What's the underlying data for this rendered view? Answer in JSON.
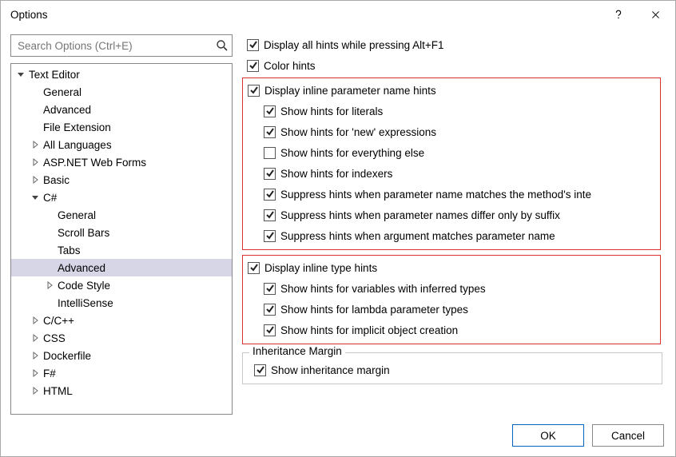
{
  "window": {
    "title": "Options"
  },
  "search": {
    "placeholder": "Search Options (Ctrl+E)"
  },
  "tree": [
    {
      "label": "Text Editor",
      "indent": 0,
      "expand": "open",
      "sel": false
    },
    {
      "label": "General",
      "indent": 1,
      "expand": "none",
      "sel": false
    },
    {
      "label": "Advanced",
      "indent": 1,
      "expand": "none",
      "sel": false
    },
    {
      "label": "File Extension",
      "indent": 1,
      "expand": "none",
      "sel": false
    },
    {
      "label": "All Languages",
      "indent": 1,
      "expand": "closed",
      "sel": false
    },
    {
      "label": "ASP.NET Web Forms",
      "indent": 1,
      "expand": "closed",
      "sel": false
    },
    {
      "label": "Basic",
      "indent": 1,
      "expand": "closed",
      "sel": false
    },
    {
      "label": "C#",
      "indent": 1,
      "expand": "open",
      "sel": false
    },
    {
      "label": "General",
      "indent": 2,
      "expand": "none",
      "sel": false
    },
    {
      "label": "Scroll Bars",
      "indent": 2,
      "expand": "none",
      "sel": false
    },
    {
      "label": "Tabs",
      "indent": 2,
      "expand": "none",
      "sel": false
    },
    {
      "label": "Advanced",
      "indent": 2,
      "expand": "none",
      "sel": true
    },
    {
      "label": "Code Style",
      "indent": 2,
      "expand": "closed",
      "sel": false
    },
    {
      "label": "IntelliSense",
      "indent": 2,
      "expand": "none",
      "sel": false
    },
    {
      "label": "C/C++",
      "indent": 1,
      "expand": "closed",
      "sel": false
    },
    {
      "label": "CSS",
      "indent": 1,
      "expand": "closed",
      "sel": false
    },
    {
      "label": "Dockerfile",
      "indent": 1,
      "expand": "closed",
      "sel": false
    },
    {
      "label": "F#",
      "indent": 1,
      "expand": "closed",
      "sel": false
    },
    {
      "label": "HTML",
      "indent": 1,
      "expand": "closed",
      "sel": false
    }
  ],
  "opts_top": [
    {
      "label": "Display all hints while pressing Alt+F1",
      "checked": true,
      "indent": 0
    },
    {
      "label": "Color hints",
      "checked": true,
      "indent": 0
    }
  ],
  "group1": [
    {
      "label": "Display inline parameter name hints",
      "checked": true,
      "indent": 0
    },
    {
      "label": "Show hints for literals",
      "checked": true,
      "indent": 1
    },
    {
      "label": "Show hints for 'new' expressions",
      "checked": true,
      "indent": 1
    },
    {
      "label": "Show hints for everything else",
      "checked": false,
      "indent": 1
    },
    {
      "label": "Show hints for indexers",
      "checked": true,
      "indent": 1
    },
    {
      "label": "Suppress hints when parameter name matches the method's inte",
      "checked": true,
      "indent": 1
    },
    {
      "label": "Suppress hints when parameter names differ only by suffix",
      "checked": true,
      "indent": 1
    },
    {
      "label": "Suppress hints when argument matches parameter name",
      "checked": true,
      "indent": 1
    }
  ],
  "group2": [
    {
      "label": "Display inline type hints",
      "checked": true,
      "indent": 0
    },
    {
      "label": "Show hints for variables with inferred types",
      "checked": true,
      "indent": 1
    },
    {
      "label": "Show hints for lambda parameter types",
      "checked": true,
      "indent": 1
    },
    {
      "label": "Show hints for implicit object creation",
      "checked": true,
      "indent": 1
    }
  ],
  "section": {
    "title": "Inheritance Margin",
    "items": [
      {
        "label": "Show inheritance margin",
        "checked": true,
        "indent": 0
      }
    ]
  },
  "buttons": {
    "ok": "OK",
    "cancel": "Cancel"
  }
}
